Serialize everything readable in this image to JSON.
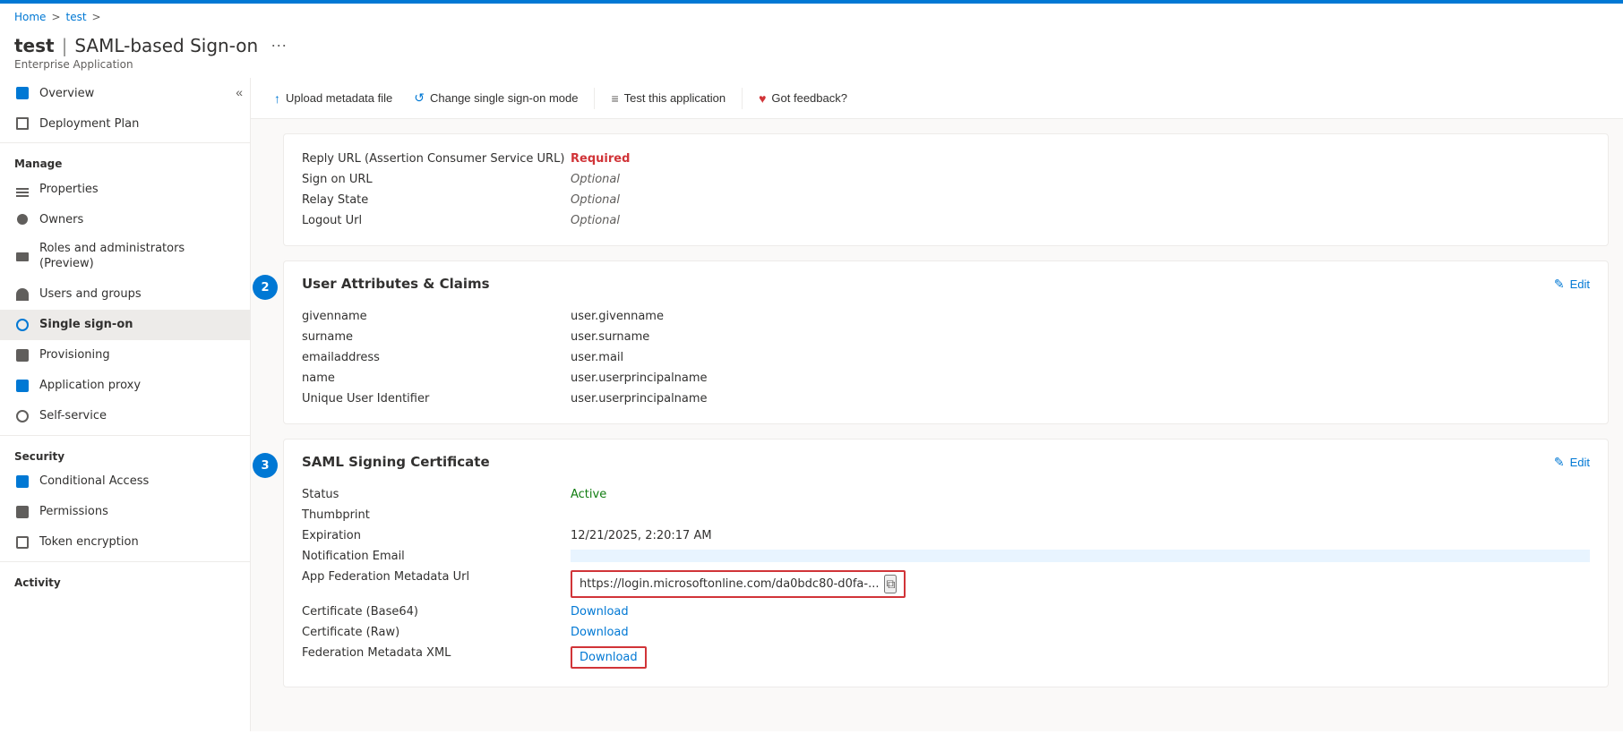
{
  "topbar": {
    "color": "#0078d4"
  },
  "breadcrumb": {
    "home": "Home",
    "test": "test",
    "separator": ">"
  },
  "header": {
    "title": "test",
    "separator": "|",
    "subtitle_prefix": "SAML-based Sign-on",
    "app_type": "Enterprise Application"
  },
  "toolbar": {
    "upload_label": "Upload metadata file",
    "change_label": "Change single sign-on mode",
    "test_label": "Test this application",
    "feedback_label": "Got feedback?"
  },
  "sidebar": {
    "collapse_tooltip": "Collapse sidebar",
    "overview": "Overview",
    "deployment_plan": "Deployment Plan",
    "manage_section": "Manage",
    "properties": "Properties",
    "owners": "Owners",
    "roles_admins": "Roles and administrators (Preview)",
    "users_groups": "Users and groups",
    "single_sign_on": "Single sign-on",
    "provisioning": "Provisioning",
    "application_proxy": "Application proxy",
    "self_service": "Self-service",
    "security_section": "Security",
    "conditional_access": "Conditional Access",
    "permissions": "Permissions",
    "token_encryption": "Token encryption",
    "activity_section": "Activity"
  },
  "basic_saml": {
    "fields": [
      {
        "label": "Reply URL (Assertion Consumer Service URL)",
        "value": "Required",
        "type": "required"
      },
      {
        "label": "Sign on URL",
        "value": "Optional",
        "type": "optional"
      },
      {
        "label": "Relay State",
        "value": "Optional",
        "type": "optional"
      },
      {
        "label": "Logout Url",
        "value": "Optional",
        "type": "optional"
      }
    ]
  },
  "user_attributes": {
    "step": "2",
    "title": "User Attributes & Claims",
    "edit_label": "Edit",
    "rows": [
      {
        "label": "givenname",
        "value": "user.givenname"
      },
      {
        "label": "surname",
        "value": "user.surname"
      },
      {
        "label": "emailaddress",
        "value": "user.mail"
      },
      {
        "label": "name",
        "value": "user.userprincipalname"
      },
      {
        "label": "Unique User Identifier",
        "value": "user.userprincipalname"
      }
    ]
  },
  "saml_cert": {
    "step": "3",
    "title": "SAML Signing Certificate",
    "edit_label": "Edit",
    "status_label": "Status",
    "status_value": "Active",
    "thumbprint_label": "Thumbprint",
    "thumbprint_value": "",
    "expiration_label": "Expiration",
    "expiration_value": "12/21/2025, 2:20:17 AM",
    "notification_label": "Notification Email",
    "notification_value": "",
    "federation_url_label": "App Federation Metadata Url",
    "federation_url_value": "https://login.microsoftonline.com/da0bdc80-d0fa-...",
    "cert_base64_label": "Certificate (Base64)",
    "cert_base64_value": "Download",
    "cert_raw_label": "Certificate (Raw)",
    "cert_raw_value": "Download",
    "fed_xml_label": "Federation Metadata XML",
    "fed_xml_value": "Download"
  }
}
